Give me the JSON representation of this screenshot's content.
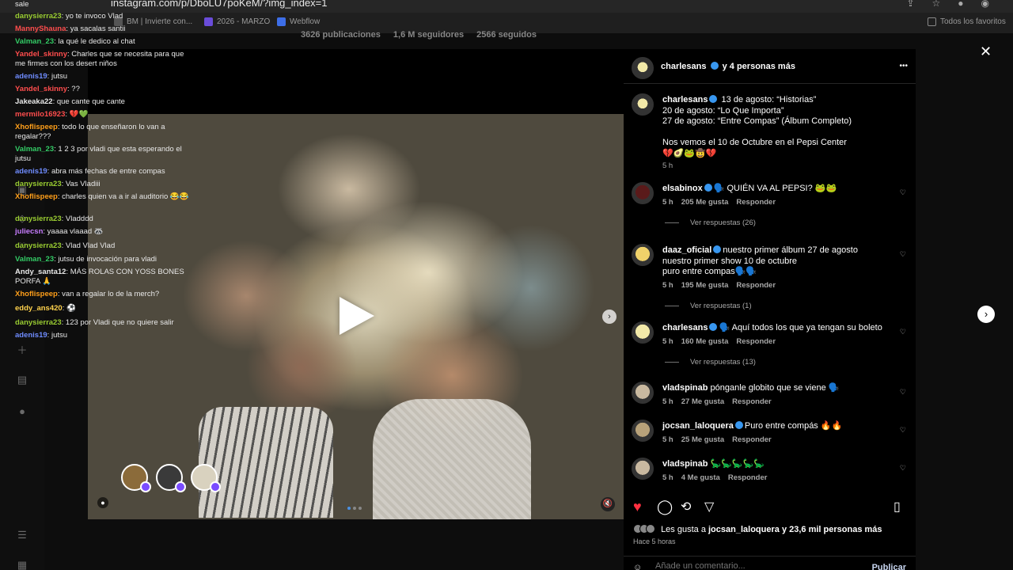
{
  "browser": {
    "url": "instagram.com/p/DboLU7poKeM/?img_index=1",
    "bookmarks": [
      "BM | Invierte con...",
      "2026 - MARZO",
      "Webflow"
    ],
    "all_favorites": "Todos los favoritos"
  },
  "profile_strip": {
    "posts": "3626 publicaciones",
    "followers": "1,6 M seguidores",
    "following": "2566 seguidos"
  },
  "chat": [
    {
      "user": "",
      "text": "sale",
      "color": "#e8e8e8"
    },
    {
      "user": "danysierra23",
      "text": "yo te invoco Vlad",
      "color": "#9acd32"
    },
    {
      "user": "MannyShauna",
      "text": "ya sacalas santii",
      "color": "#ff4d4d"
    },
    {
      "user": "Valman_23",
      "text": "la qué le dedico al chat",
      "color": "#33cc66"
    },
    {
      "user": "Yandel_skinny",
      "text": "Charles que se necesita para que me firmes con los desert niños",
      "color": "#ff4d4d"
    },
    {
      "user": "adenis19",
      "text": "jutsu",
      "color": "#6f8cff"
    },
    {
      "user": "Yandel_skinny",
      "text": "??",
      "color": "#ff4d4d"
    },
    {
      "user": "Jakeaka22",
      "text": "que cante que cante",
      "color": "#e8e8e8"
    },
    {
      "user": "mermilo16923",
      "text": "💔💚",
      "color": "#ff4d4d"
    },
    {
      "user": "Xhoflispeep",
      "text": "todo lo que enseñaron lo van a regalar???",
      "color": "#ff9f1a"
    },
    {
      "user": "Valman_23",
      "text": "1 2 3 por vladi que esta esperando el jutsu",
      "color": "#33cc66"
    },
    {
      "user": "adenis19",
      "text": "abra más fechas de entre compas",
      "color": "#6f8cff"
    },
    {
      "user": "danysierra23",
      "text": "Vas Vladiii",
      "color": "#9acd32"
    },
    {
      "user": "Xhoflispeep",
      "text": "charles quien va a ir al auditorio 😂😂",
      "color": "#ff9f1a"
    },
    {
      "user": "danysierra23",
      "text": "Vladddd",
      "color": "#9acd32"
    },
    {
      "user": "juliecsn",
      "text": "yaaaa vlaaad 🦝",
      "color": "#c77dff"
    },
    {
      "user": "danysierra23",
      "text": "Vlad Vlad Vlad",
      "color": "#9acd32"
    },
    {
      "user": "Valman_23",
      "text": "jutsu de invocación para vladi",
      "color": "#33cc66"
    },
    {
      "user": "Andy_santa12",
      "text": "MÁS ROLAS CON YOSS BONES PORFA 🙏",
      "color": "#e8e8e8"
    },
    {
      "user": "Xhoflispeep",
      "text": "van a regalar lo de la merch?",
      "color": "#ff9f1a"
    },
    {
      "user": "eddy_ans420",
      "text": "⚽",
      "color": "#ffd24d"
    },
    {
      "user": "danysierra23",
      "text": "123 por Vladi que no quiere salir",
      "color": "#9acd32"
    },
    {
      "user": "adenis19",
      "text": "jutsu",
      "color": "#6f8cff"
    }
  ],
  "post": {
    "header_user": "charlesans",
    "header_more": "y 4 personas más",
    "caption_user": "charlesans",
    "caption_lines": [
      "13 de agosto: “Historias”",
      "20 de agosto: “Lo Que Importa”",
      "27 de agosto: “Entre Compas” (Álbum Completo)",
      "",
      "Nos vemos el 10 de Octubre en el Pepsi Center",
      "💔🥑🐸🤠💔"
    ],
    "caption_time": "5 h",
    "comments": [
      {
        "user": "elsabinox",
        "verified": true,
        "text": "🗣️ QUIÉN VA AL PEPSI? 🐸🐸",
        "time": "5 h",
        "likes": "205 Me gusta",
        "reply": "Responder",
        "view_replies": "Ver respuestas (26)"
      },
      {
        "user": "daaz_oficial",
        "verified": true,
        "text": "nuestro primer álbum 27 de agosto\nnuestro primer show 10 de octubre\npuro entre compas🗣️🗣️",
        "time": "5 h",
        "likes": "195 Me gusta",
        "reply": "Responder",
        "view_replies": "Ver respuestas (1)"
      },
      {
        "user": "charlesans",
        "verified": true,
        "text": "🗣️ Aquí todos los que ya tengan su boleto",
        "time": "5 h",
        "likes": "160 Me gusta",
        "reply": "Responder",
        "view_replies": "Ver respuestas (13)"
      },
      {
        "user": "vladspinab",
        "verified": false,
        "text": "pónganle globito que se viene 🗣️",
        "time": "5 h",
        "likes": "27 Me gusta",
        "reply": "Responder",
        "view_replies": ""
      },
      {
        "user": "jocsan_laloquera",
        "verified": true,
        "text": "Puro entre compás 🔥🔥",
        "time": "5 h",
        "likes": "25 Me gusta",
        "reply": "Responder",
        "view_replies": ""
      },
      {
        "user": "vladspinab",
        "verified": false,
        "text": "🦕🦕🦕🦕🦕",
        "time": "5 h",
        "likes": "4 Me gusta",
        "reply": "Responder",
        "view_replies": ""
      }
    ],
    "likes_prefix": "Les gusta a",
    "likes_user": "jocsan_laloquera",
    "likes_suffix": "y 23,6 mil personas más",
    "posted_ago": "Hace 5 horas",
    "add_comment_placeholder": "Añade un comentario...",
    "publish": "Publicar"
  },
  "icons": {
    "close": "✕",
    "next": "›",
    "more": "•••"
  }
}
